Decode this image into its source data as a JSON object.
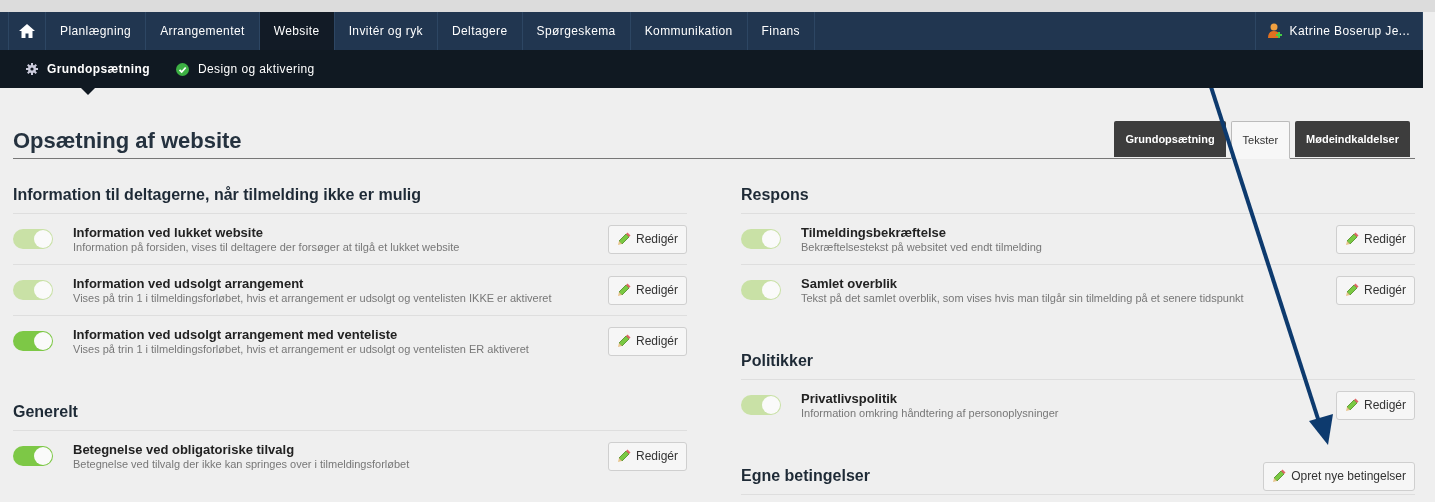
{
  "nav": {
    "tabs": [
      {
        "label": "Planlægning",
        "selected": false
      },
      {
        "label": "Arrangementet",
        "selected": false
      },
      {
        "label": "Website",
        "selected": true
      },
      {
        "label": "Invitér og ryk",
        "selected": false
      },
      {
        "label": "Deltagere",
        "selected": false
      },
      {
        "label": "Spørgeskema",
        "selected": false
      },
      {
        "label": "Kommunikation",
        "selected": false
      },
      {
        "label": "Finans",
        "selected": false
      }
    ],
    "user": "Katrine Boserup Je..."
  },
  "subnav": {
    "items": [
      {
        "label": "Grundopsætning",
        "kind": "gear",
        "selected": true
      },
      {
        "label": "Design og aktivering",
        "kind": "check",
        "selected": false
      }
    ]
  },
  "page": {
    "title": "Opsætning af website",
    "tabs": [
      {
        "label": "Grundopsætning",
        "selected": false
      },
      {
        "label": "Tekster",
        "selected": true
      },
      {
        "label": "Mødeindkaldelser",
        "selected": false
      }
    ]
  },
  "columns": [
    [
      {
        "title": "Information til deltagerne, når tilmelding ikke er mulig",
        "rows": [
          {
            "name": "Information ved lukket website",
            "description": "Information på forsiden, vises til deltagere der forsøger at tilgå et lukket website",
            "disabled": true,
            "button": "Redigér"
          },
          {
            "name": "Information ved udsolgt arrangement",
            "description": "Vises på trin 1 i tilmeldingsforløbet, hvis et arrangement er udsolgt og ventelisten IKKE er aktiveret",
            "disabled": true,
            "button": "Redigér"
          },
          {
            "name": "Information ved udsolgt arrangement med venteliste",
            "description": "Vises på trin 1 i tilmeldingsforløbet, hvis et arrangement er udsolgt og ventelisten ER aktiveret",
            "disabled": false,
            "button": "Redigér"
          }
        ]
      },
      {
        "title": "Generelt",
        "rows": [
          {
            "name": "Betegnelse ved obligatoriske tilvalg",
            "description": "Betegnelse ved tilvalg der ikke kan springes over i tilmeldingsforløbet",
            "disabled": false,
            "button": "Redigér"
          }
        ]
      }
    ],
    [
      {
        "title": "Respons",
        "rows": [
          {
            "name": "Tilmeldingsbekræftelse",
            "description": "Bekræftelsestekst på websitet ved endt tilmelding",
            "disabled": true,
            "button": "Redigér"
          },
          {
            "name": "Samlet overblik",
            "description": "Tekst på det samlet overblik, som vises hvis man tilgår sin tilmelding på et senere tidspunkt",
            "disabled": true,
            "button": "Redigér"
          }
        ]
      },
      {
        "title": "Politikker",
        "rows": [
          {
            "name": "Privatlivspolitik",
            "description": "Information omkring håndtering af personoplysninger",
            "disabled": true,
            "button": "Redigér"
          }
        ]
      },
      {
        "title": "Egne betingelser",
        "action": "Opret nye betingelser"
      }
    ]
  ]
}
